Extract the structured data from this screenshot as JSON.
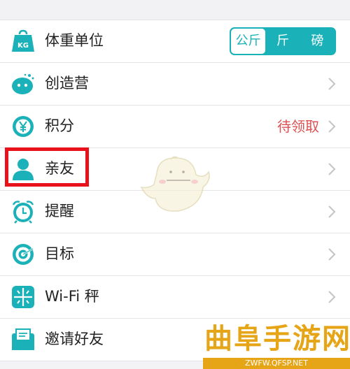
{
  "settings": {
    "rows": [
      {
        "label": "体重单位",
        "icon": "kg-weight-icon"
      },
      {
        "label": "创造营",
        "icon": "mascot-face-icon"
      },
      {
        "label": "积分",
        "icon": "yen-coin-icon",
        "value": "待领取"
      },
      {
        "label": "亲友",
        "icon": "person-icon"
      },
      {
        "label": "提醒",
        "icon": "alarm-clock-icon"
      },
      {
        "label": "目标",
        "icon": "target-icon"
      },
      {
        "label": "Wi-Fi 秤",
        "icon": "scale-icon"
      },
      {
        "label": "邀请好友",
        "icon": "envelope-icon"
      }
    ],
    "weight_units": {
      "options": [
        "公斤",
        "斤",
        "磅"
      ],
      "selected": "公斤"
    },
    "icon_kg_text": "KG",
    "accent_color": "#1ab2b8",
    "highlight_color": "#e8121a",
    "value_color": "#e05050"
  },
  "watermark": {
    "title": "曲阜手游网",
    "url": "ZWFW.QFSP.NET"
  }
}
